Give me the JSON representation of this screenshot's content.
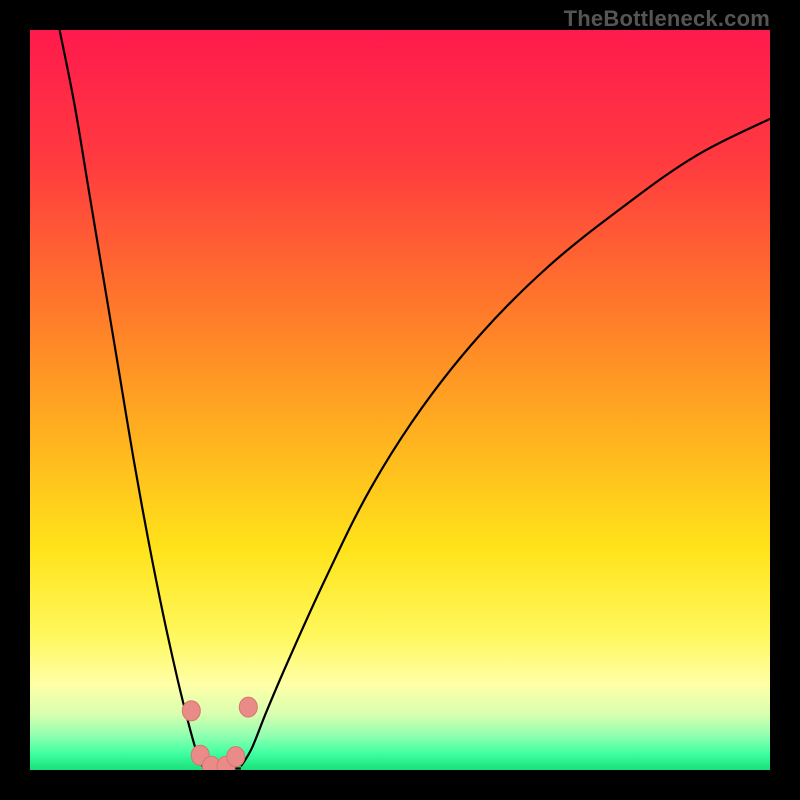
{
  "watermark": "TheBottleneck.com",
  "colors": {
    "frame": "#000000",
    "gradient_stops": [
      {
        "offset": 0.0,
        "color": "#ff1a4d"
      },
      {
        "offset": 0.18,
        "color": "#ff3b3f"
      },
      {
        "offset": 0.38,
        "color": "#ff7a2a"
      },
      {
        "offset": 0.55,
        "color": "#ffb21f"
      },
      {
        "offset": 0.7,
        "color": "#ffe31a"
      },
      {
        "offset": 0.82,
        "color": "#fff85e"
      },
      {
        "offset": 0.885,
        "color": "#ffffa8"
      },
      {
        "offset": 0.925,
        "color": "#d8ffb0"
      },
      {
        "offset": 0.955,
        "color": "#8cffb0"
      },
      {
        "offset": 0.978,
        "color": "#3effa0"
      },
      {
        "offset": 1.0,
        "color": "#18e07a"
      }
    ],
    "curve": "#000000",
    "marker_fill": "#e98b87",
    "marker_stroke": "#d9746f"
  },
  "chart_data": {
    "type": "line",
    "title": "",
    "xlabel": "",
    "ylabel": "",
    "xlim": [
      0,
      100
    ],
    "ylim": [
      0,
      100
    ],
    "description": "Bottleneck mismatch curve: y is the performance gap (≈0 is balanced / green band, ≈100 is severe / red). The curve has a sharp minimum near x≈25 and rises steeply on both sides, more steeply on the left.",
    "left_branch": {
      "x": [
        4,
        6,
        8,
        10,
        12,
        14,
        16,
        18,
        20,
        21.5,
        22.5,
        23.3
      ],
      "y": [
        100,
        90,
        78,
        66,
        54,
        42,
        31,
        21,
        12,
        6,
        2.5,
        0.5
      ]
    },
    "right_branch": {
      "x": [
        28.5,
        30,
        32,
        35,
        40,
        46,
        53,
        61,
        70,
        80,
        90,
        100
      ],
      "y": [
        0.5,
        3,
        8,
        15,
        26,
        38,
        49,
        59,
        68,
        76,
        83,
        88
      ]
    },
    "floor": {
      "x_start": 23.3,
      "x_end": 28.5,
      "y": 0.2
    },
    "markers": [
      {
        "x": 21.8,
        "y": 8.0
      },
      {
        "x": 23.0,
        "y": 2.0
      },
      {
        "x": 24.5,
        "y": 0.5
      },
      {
        "x": 26.5,
        "y": 0.5
      },
      {
        "x": 27.8,
        "y": 1.8
      },
      {
        "x": 29.5,
        "y": 8.5
      }
    ]
  }
}
